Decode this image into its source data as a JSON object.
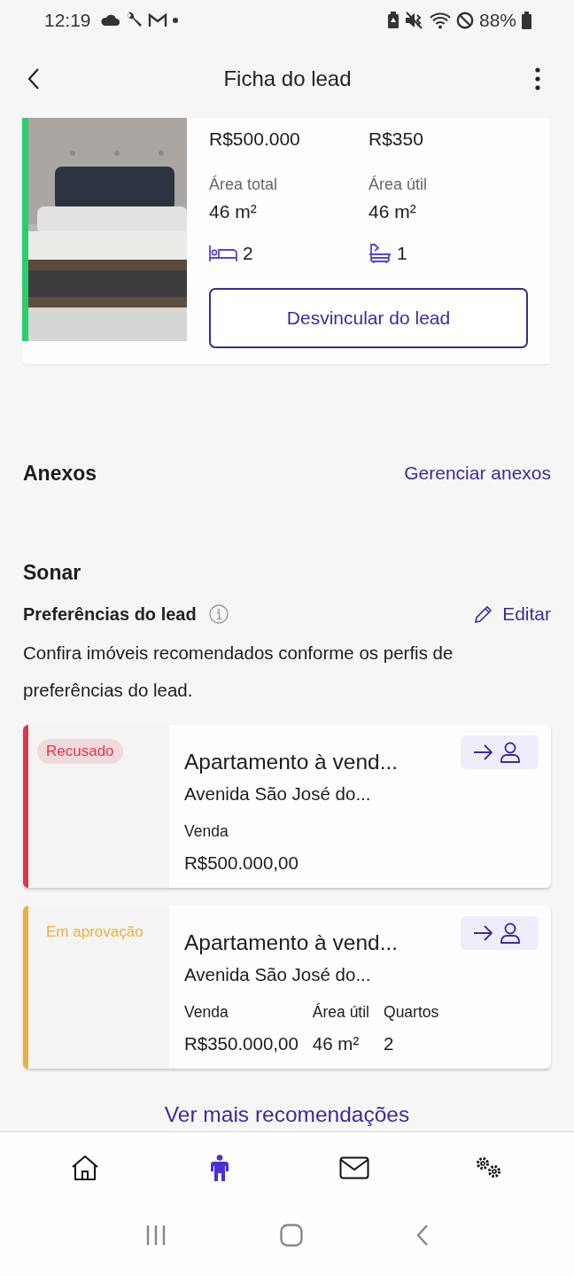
{
  "status_bar": {
    "time": "12:19",
    "battery": "88%"
  },
  "header": {
    "title": "Ficha do lead"
  },
  "property": {
    "color": "#2ecc71",
    "price": "R$500.000",
    "condo": "R$350",
    "area_total_label": "Área total",
    "area_total": "46 m²",
    "area_util_label": "Área útil",
    "area_util": "46 m²",
    "bedrooms": "2",
    "bathrooms": "1",
    "unlink_button": "Desvincular do lead"
  },
  "attachments": {
    "title": "Anexos",
    "action": "Gerenciar anexos"
  },
  "sonar": {
    "title": "Sonar",
    "subtitle": "Preferências do lead",
    "edit": "Editar",
    "description": "Confira imóveis recomendados conforme os perfis de preferências do lead.",
    "recommendations": [
      {
        "status": "Recusado",
        "color": "#e0364c",
        "title": "Apartamento à vend...",
        "address": "Avenida São José do...",
        "fields": [
          {
            "label": "Venda",
            "value": "R$500.000,00"
          }
        ]
      },
      {
        "status": "Em aprovação",
        "color": "#e8b040",
        "title": "Apartamento à vend...",
        "address": "Avenida São José do...",
        "fields": [
          {
            "label": "Venda",
            "value": "R$350.000,00"
          },
          {
            "label": "Área útil",
            "value": "46 m²"
          },
          {
            "label": "Quartos",
            "value": "2"
          }
        ]
      }
    ],
    "more": "Ver mais recomendações"
  },
  "bottom_nav": [
    {
      "kind": "home",
      "selected": false
    },
    {
      "kind": "person",
      "selected": true
    },
    {
      "kind": "mail",
      "selected": false
    },
    {
      "kind": "settings",
      "selected": false
    }
  ]
}
